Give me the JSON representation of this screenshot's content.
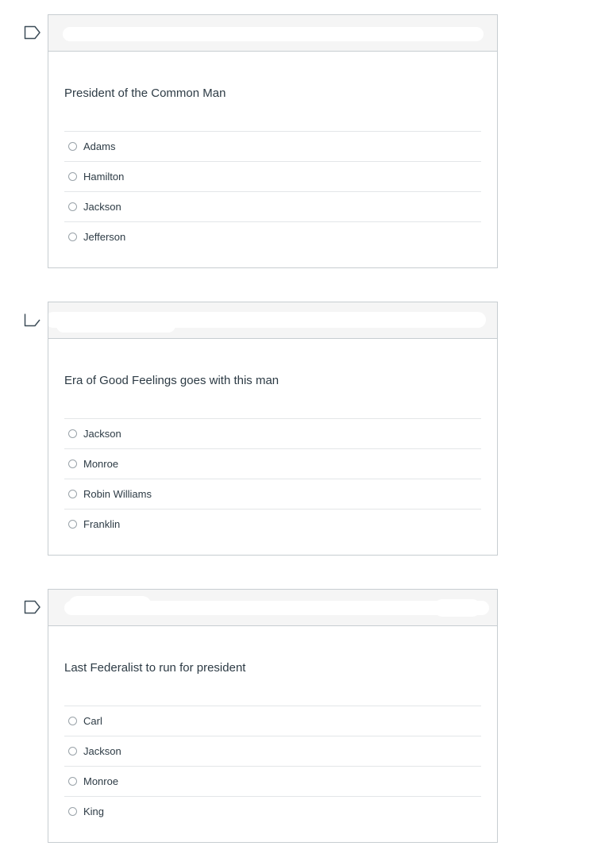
{
  "icons": {
    "flag": "flag-outline-icon",
    "radio": "radio-button-empty-icon"
  },
  "colors": {
    "border": "#c7cdd1",
    "header_background": "#f5f5f5",
    "text": "#2d3b45"
  },
  "questions": [
    {
      "text": "President of the Common Man",
      "answers": [
        "Adams",
        "Hamilton",
        "Jackson",
        "Jefferson"
      ]
    },
    {
      "text": "Era of Good Feelings goes with this man",
      "answers": [
        "Jackson",
        "Monroe",
        "Robin Williams",
        "Franklin"
      ]
    },
    {
      "text": "Last Federalist to run for president",
      "answers": [
        "Carl",
        "Jackson",
        "Monroe",
        "King"
      ]
    }
  ]
}
